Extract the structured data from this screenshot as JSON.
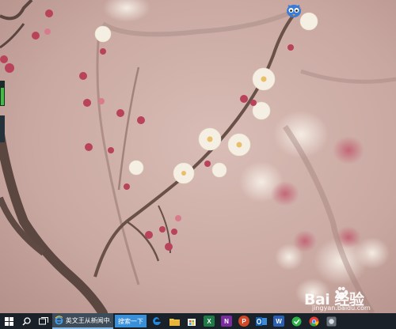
{
  "taskbar": {
    "browser_task_label": "英文王从新闻中...",
    "search_label": "搜索一下",
    "app_letters": {
      "excel": "X",
      "onenote": "N",
      "powerpoint": "P",
      "word": "W"
    }
  },
  "watermark": {
    "brand": "Bai 经验",
    "url": "jingyan.baidu.com"
  },
  "colors": {
    "taskbar": "#1b2128",
    "active_task": "#3e4b58",
    "search_button": "#3a8fd9",
    "wallpaper_background": "#c8a9a2"
  },
  "icons": [
    "windows-start-icon",
    "search-icon",
    "task-view-icon",
    "ie-icon",
    "edge-icon",
    "file-explorer-icon",
    "store-icon",
    "excel-icon",
    "onenote-icon",
    "powerpoint-icon",
    "outlook-icon",
    "word-icon",
    "green-app-icon",
    "chrome-icon",
    "extra-app-icon",
    "mascot-icon",
    "baidu-paw-icon"
  ]
}
